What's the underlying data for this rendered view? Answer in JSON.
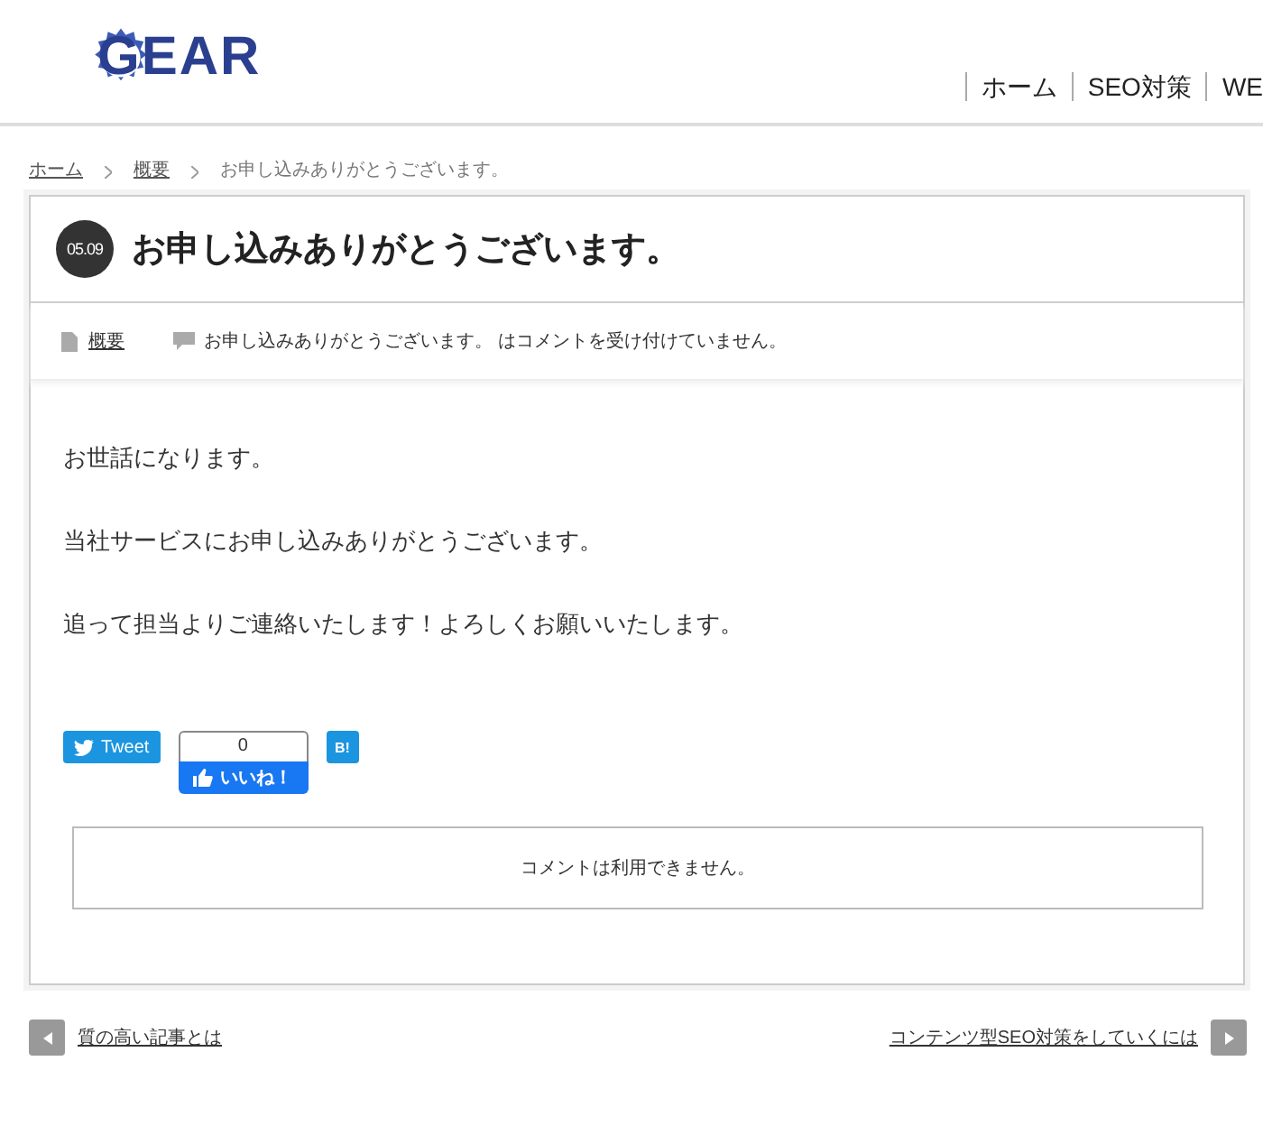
{
  "header": {
    "logo": "GEAR",
    "nav": [
      "ホーム",
      "SEO対策",
      "WE"
    ]
  },
  "breadcrumb": [
    {
      "label": "ホーム",
      "link": true
    },
    {
      "label": "概要",
      "link": true
    },
    {
      "label": "お申し込みありがとうございます。",
      "link": false
    }
  ],
  "post": {
    "date": "05.09",
    "title": "お申し込みありがとうございます。",
    "category": "概要",
    "comment_note": "お申し込みありがとうございます。 はコメントを受け付けていません。",
    "paragraphs": [
      "お世話になります。",
      "当社サービスにお申し込みありがとうございます。",
      "追って担当よりご連絡いたします！よろしくお願いいたします。"
    ],
    "share": {
      "tweet": "Tweet",
      "like_count": "0",
      "like": "いいね！",
      "hatena": "B!"
    },
    "comments_closed": "コメントは利用できません。"
  },
  "pager": {
    "prev": "質の高い記事とは",
    "next": "コンテンツ型SEO対策をしていくには"
  }
}
